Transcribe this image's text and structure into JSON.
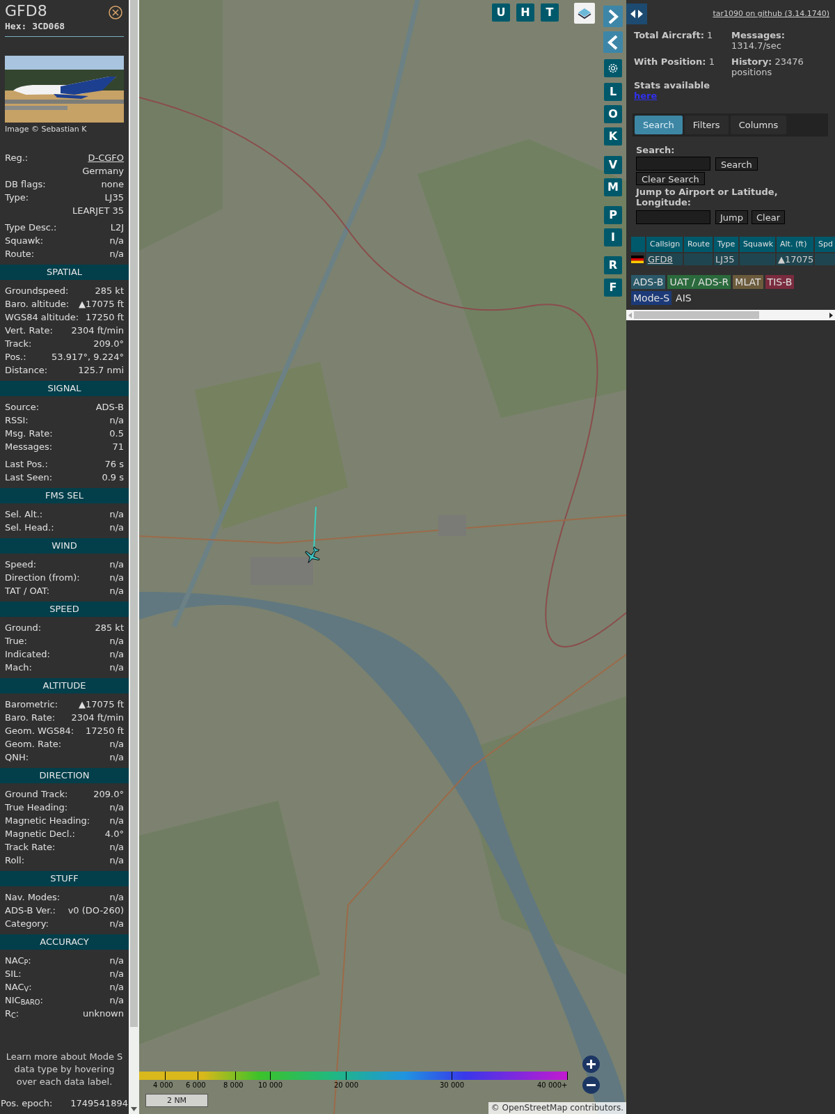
{
  "aircraft": {
    "callsign": "GFD8",
    "hex": "Hex: 3CD068",
    "photo_credit": "Image © Sebastian K",
    "top_groups": [
      [
        {
          "kind": "link",
          "label": "Reg.:",
          "value": "D-CGFO"
        },
        {
          "kind": "value",
          "value": "Germany"
        },
        {
          "kind": "field",
          "label": "DB flags:",
          "value": "none"
        },
        {
          "kind": "field",
          "label": "Type:",
          "value": "LJ35"
        },
        {
          "kind": "value",
          "value": "LEARJET 35"
        }
      ],
      [
        {
          "kind": "field",
          "label": "Type Desc.:",
          "value": "L2J"
        },
        {
          "kind": "field",
          "label": "Squawk:",
          "value": "n/a"
        },
        {
          "kind": "field",
          "label": "Route:",
          "value": "n/a"
        }
      ]
    ],
    "sections": [
      {
        "heading": "SPATIAL",
        "groups": [
          [
            {
              "label": "Groundspeed:",
              "value": "285 kt"
            },
            {
              "label": "Baro. altitude:",
              "value": "▲17075 ft"
            },
            {
              "label": "WGS84 altitude:",
              "value": "17250 ft"
            },
            {
              "label": "Vert. Rate:",
              "value": "2304 ft/min"
            },
            {
              "label": "Track:",
              "value": "209.0°"
            },
            {
              "label": "Pos.:",
              "value": "53.917°, 9.224°"
            },
            {
              "label": "Distance:",
              "value": "125.7 nmi"
            }
          ]
        ]
      },
      {
        "heading": "SIGNAL",
        "groups": [
          [
            {
              "label": "Source:",
              "value": "ADS-B"
            },
            {
              "label": "RSSI:",
              "value": "n/a"
            },
            {
              "label": "Msg. Rate:",
              "value": "0.5"
            },
            {
              "label": "Messages:",
              "value": "71"
            }
          ],
          [
            {
              "label": "Last Pos.:",
              "value": "76 s"
            },
            {
              "label": "Last Seen:",
              "value": "0.9 s"
            }
          ]
        ]
      },
      {
        "heading": "FMS SEL",
        "groups": [
          [
            {
              "label": "Sel. Alt.:",
              "value": "n/a"
            },
            {
              "label": "Sel. Head.:",
              "value": "n/a"
            }
          ]
        ]
      },
      {
        "heading": "WIND",
        "groups": [
          [
            {
              "label": "Speed:",
              "value": "n/a"
            },
            {
              "label": "Direction (from):",
              "value": "n/a"
            },
            {
              "label": "TAT / OAT:",
              "value": "n/a"
            }
          ]
        ]
      },
      {
        "heading": "SPEED",
        "groups": [
          [
            {
              "label": "Ground:",
              "value": "285 kt"
            },
            {
              "label": "True:",
              "value": "n/a"
            },
            {
              "label": "Indicated:",
              "value": "n/a"
            },
            {
              "label": "Mach:",
              "value": "n/a"
            }
          ]
        ]
      },
      {
        "heading": "ALTITUDE",
        "groups": [
          [
            {
              "label": "Barometric:",
              "value": "▲17075 ft"
            },
            {
              "label": "Baro. Rate:",
              "value": "2304 ft/min"
            },
            {
              "label": "Geom. WGS84:",
              "value": "17250 ft"
            },
            {
              "label": "Geom. Rate:",
              "value": "n/a"
            },
            {
              "label": "QNH:",
              "value": "n/a"
            }
          ]
        ]
      },
      {
        "heading": "DIRECTION",
        "groups": [
          [
            {
              "label": "Ground Track:",
              "value": "209.0°"
            },
            {
              "label": "True Heading:",
              "value": "n/a"
            },
            {
              "label": "Magnetic Heading:",
              "value": "n/a"
            },
            {
              "label": "Magnetic Decl.:",
              "value": "4.0°"
            },
            {
              "label": "Track Rate:",
              "value": "n/a"
            },
            {
              "label": "Roll:",
              "value": "n/a"
            }
          ]
        ]
      },
      {
        "heading": "STUFF",
        "groups": [
          [
            {
              "label": "Nav. Modes:",
              "value": "n/a"
            },
            {
              "label": "ADS-B Ver.:",
              "value": "v0 (DO-260)"
            },
            {
              "label": "Category:",
              "value": "n/a"
            }
          ]
        ]
      },
      {
        "heading": "ACCURACY",
        "groups": [
          [
            {
              "label": "NAC$_{P}$:",
              "value": "n/a"
            },
            {
              "label": "SIL:",
              "value": "n/a"
            },
            {
              "label": "NAC$_{V}$:",
              "value": "n/a"
            },
            {
              "label": "NIC$_{BARO}$:",
              "value": "n/a"
            },
            {
              "label": "R$_{C}$:",
              "value": "unknown"
            }
          ]
        ]
      }
    ],
    "note": "Learn more about Mode S data type by hovering over each data label.",
    "epoch": {
      "label": "Pos. epoch:",
      "value": "1749541894"
    }
  },
  "map": {
    "top_buttons": [
      "U",
      "H",
      "T"
    ],
    "side_buttons": [
      {
        "kind": "next"
      },
      {
        "kind": "prev"
      },
      {
        "kind": "settings"
      },
      {
        "kind": "letter",
        "label": "L"
      },
      {
        "kind": "letter",
        "label": "O"
      },
      {
        "kind": "letter",
        "label": "K"
      },
      {
        "kind": "letter",
        "label": "V"
      },
      {
        "kind": "letter",
        "label": "M"
      },
      {
        "kind": "letter",
        "label": "P"
      },
      {
        "kind": "letter",
        "label": "I"
      },
      {
        "kind": "letter",
        "label": "R"
      },
      {
        "kind": "letter",
        "label": "F"
      }
    ],
    "altitude_legend": [
      "4 000",
      "6 000",
      "8 000",
      "10 000",
      "20 000",
      "30 000",
      "40 000+"
    ],
    "scale": "2 NM",
    "attribution": "© OpenStreetMap contributors."
  },
  "panel": {
    "github_link": "tar1090 on github (3.14.1740)",
    "stats": [
      {
        "text": "**Total Aircraft:** 1"
      },
      {
        "text": "**Messages:** 1314.7/sec"
      },
      {
        "text": "**With Position:** 1"
      },
      {
        "text": "**History:** 23476 positions"
      }
    ],
    "stats_note": "Stats available",
    "stats_link": "here",
    "tabs": [
      {
        "label": "Search",
        "selected": true
      },
      {
        "label": "Filters",
        "selected": false
      },
      {
        "label": "Columns",
        "selected": false
      }
    ],
    "search_label": "Search:",
    "search_button": "Search",
    "clear_search_button": "Clear Search",
    "jump_label": "Jump to Airport or Latitude, Longitude:",
    "jump_button": "Jump",
    "clear_button": "Clear",
    "table": {
      "columns": [
        "Callsign",
        "Route",
        "Type",
        "Squawk",
        "Alt. (ft)",
        "Spd"
      ],
      "rows": [
        {
          "callsign": "GFD8",
          "type": "LJ35",
          "altitude": "▲17075"
        }
      ]
    },
    "legend": [
      {
        "label": "ADS-B",
        "color": "#2a5868"
      },
      {
        "label": "UAT / ADS-R",
        "color": "#2b6a3c"
      },
      {
        "label": "MLAT",
        "color": "#6b5b3c"
      },
      {
        "label": "TIS-B",
        "color": "#7a2c3e"
      },
      {
        "label": "Mode-S",
        "color": "#1c3a78"
      },
      {
        "label": "AIS",
        "color": "#2f2f2f"
      }
    ]
  }
}
